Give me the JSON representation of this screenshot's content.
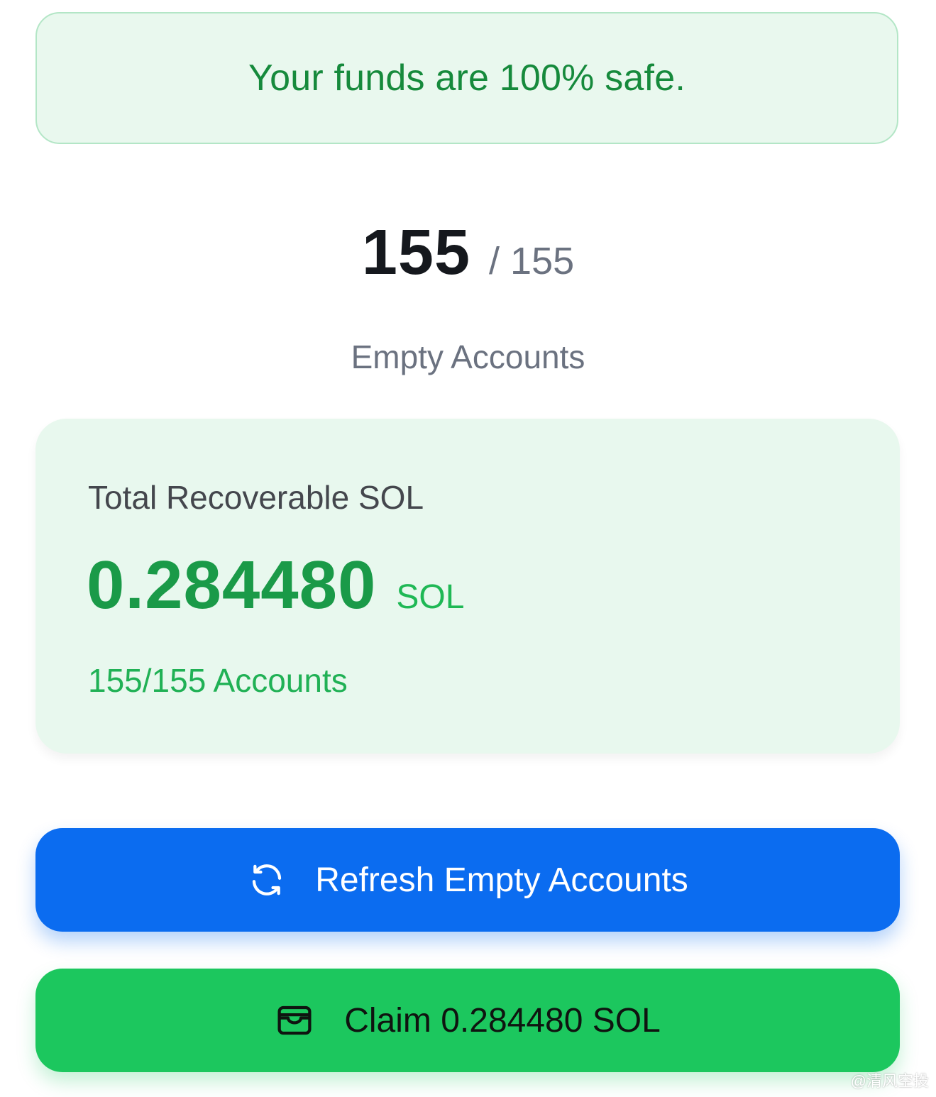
{
  "banner": {
    "text": "Your funds are 100% safe."
  },
  "counter": {
    "count": "155",
    "total": "/ 155",
    "label": "Empty Accounts"
  },
  "recoverable": {
    "title": "Total Recoverable SOL",
    "amount": "0.284480",
    "unit": "SOL",
    "accounts": "155/155 Accounts"
  },
  "buttons": {
    "refresh_label": "Refresh Empty Accounts",
    "refresh_icon": "refresh-icon",
    "claim_label": "Claim 0.284480 SOL",
    "claim_icon": "wallet-icon"
  },
  "watermark": {
    "text": "@清风空投"
  },
  "colors": {
    "accent_green": "#1a9a48",
    "refresh_blue": "#0b6cf0",
    "claim_green": "#1cc75e",
    "banner_bg": "#e9f8ee"
  }
}
